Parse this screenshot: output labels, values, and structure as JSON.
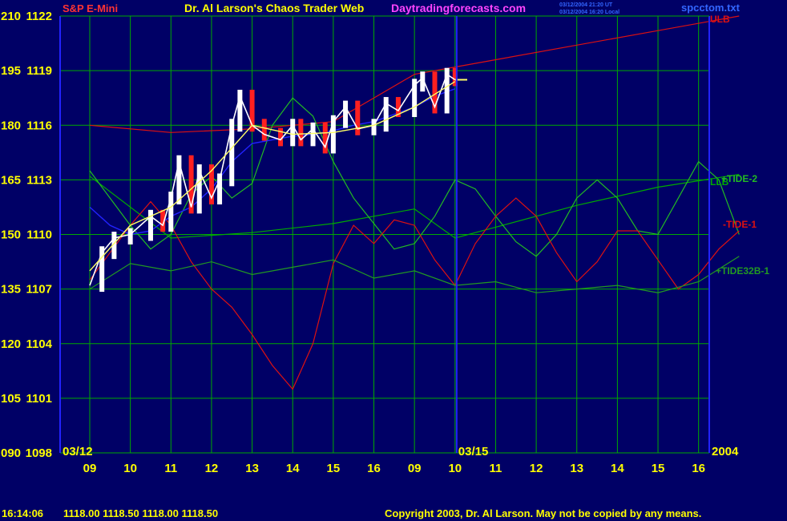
{
  "header": {
    "instrument": "S&P E-Mini",
    "title": "Dr. Al Larson's Chaos Trader Web",
    "site": "Daytradingforecasts.com",
    "timestamp_ut": "03/12/2004 21:20 UT",
    "timestamp_local": "03/12/2004 16:20 Local",
    "filename": "spcctom.txt"
  },
  "footer": {
    "clock": "16:14:06",
    "quote": "1118.00 1118.50 1118.00 1118.50",
    "copyright": "Copyright 2003, Dr. Al Larson. May not be copied by any means."
  },
  "colors": {
    "background": "#000066",
    "grid": "#00aa00",
    "price_bar": "#ffffff",
    "price_bar_down": "#ff2020",
    "axis_text": "#ffff00",
    "band": "#dd1111",
    "tide_1": "#dd1111",
    "tide_2": "#22bb22",
    "tide32b": "#229922",
    "moving_avg": "#ffff66",
    "blue_line": "#2222ff",
    "title": "#ffff00",
    "instrument": "#ff3333",
    "site": "#ff44ff",
    "filename": "#3366ff"
  },
  "chart_data": {
    "type": "line",
    "left_axis_labels": [
      "210",
      "195",
      "180",
      "165",
      "150",
      "135",
      "120",
      "105",
      "090"
    ],
    "price_axis_labels": [
      "1122",
      "1119",
      "1116",
      "1113",
      "1110",
      "1107",
      "1104",
      "1101",
      "1098"
    ],
    "price_range": [
      1098,
      1122
    ],
    "index_range": [
      90,
      210
    ],
    "x_tick_labels": [
      "09",
      "10",
      "11",
      "12",
      "13",
      "14",
      "15",
      "16",
      "09",
      "10",
      "11",
      "12",
      "13",
      "14",
      "15",
      "16"
    ],
    "date_labels": [
      "03/12",
      "03/15",
      "2004"
    ],
    "right_labels": [
      "ULB",
      "LLB",
      "+TIDE-2",
      "-TIDE-1",
      "+TIDE32B-1"
    ],
    "series": [
      {
        "name": "ULB",
        "x": [
          0,
          2,
          4,
          6,
          8,
          9,
          10,
          12,
          14,
          16
        ],
        "values": [
          1116,
          1115.6,
          1115.8,
          1116.2,
          1118.8,
          1119.2,
          1119.6,
          1120.4,
          1121.2,
          1122
        ]
      },
      {
        "name": "LLB",
        "x": [
          0,
          2,
          4,
          6,
          8,
          9,
          10,
          12,
          14,
          16
        ],
        "values": [
          1113.2,
          1109.8,
          1110.1,
          1110.6,
          1111.4,
          1109.8,
          1110.4,
          1111.6,
          1112.6,
          1113.3
        ]
      },
      {
        "name": "+TIDE-2",
        "x": [
          0,
          0.5,
          1,
          1.5,
          2,
          2.5,
          3,
          3.5,
          4,
          4.5,
          5,
          5.5,
          6,
          6.5,
          7,
          7.5,
          8,
          8.5,
          9,
          9.5,
          10,
          10.5,
          11,
          11.5,
          12,
          12.5,
          13,
          13.5,
          14,
          14.5,
          15,
          15.5,
          16
        ],
        "values": [
          1113.5,
          1112,
          1110.5,
          1109.2,
          1110,
          1112.2,
          1113.2,
          1112,
          1112.8,
          1116,
          1117.5,
          1116.5,
          1114,
          1112,
          1110.6,
          1109.2,
          1109.5,
          1111,
          1113,
          1112.5,
          1111,
          1109.6,
          1108.8,
          1110,
          1112,
          1113,
          1112,
          1110.2,
          1110,
          1112,
          1114,
          1113,
          1110
        ]
      },
      {
        "name": "-TIDE-1",
        "x": [
          0,
          0.5,
          1,
          1.5,
          2,
          2.5,
          3,
          3.5,
          4,
          4.5,
          5,
          5.5,
          6,
          6.5,
          7,
          7.5,
          8,
          8.5,
          9,
          9.5,
          10,
          10.5,
          11,
          11.5,
          12,
          12.5,
          13,
          13.5,
          14,
          14.5,
          15,
          15.5,
          16
        ],
        "values": [
          1107.5,
          1109,
          1110.5,
          1111.8,
          1110.5,
          1108.5,
          1107,
          1106,
          1104.5,
          1102.8,
          1101.5,
          1104,
          1108.4,
          1110.5,
          1109.5,
          1110.8,
          1110.5,
          1108.6,
          1107.2,
          1109.5,
          1111,
          1112,
          1111,
          1109,
          1107.4,
          1108.5,
          1110.2,
          1110.2,
          1108.6,
          1107,
          1107.8,
          1109.2,
          1110.2
        ]
      },
      {
        "name": "+TIDE32B-1",
        "x": [
          0,
          1,
          2,
          3,
          4,
          5,
          6,
          7,
          8,
          9,
          10,
          11,
          12,
          13,
          14,
          15,
          16
        ],
        "values": [
          1107,
          1108.4,
          1108,
          1108.5,
          1107.8,
          1108.2,
          1108.6,
          1107.6,
          1108,
          1107.2,
          1107.4,
          1106.8,
          1107,
          1107.2,
          1106.8,
          1107.4,
          1108.8
        ]
      }
    ],
    "price": {
      "x": [
        0,
        0.3,
        0.6,
        1,
        1.5,
        1.8,
        2,
        2.2,
        2.5,
        2.7,
        3,
        3.2,
        3.5,
        3.7,
        4,
        4.3,
        4.7,
        5,
        5.2,
        5.5,
        5.8,
        6,
        6.3,
        6.6,
        7,
        7.3,
        7.6,
        8,
        8.2,
        8.5,
        8.8,
        9
      ],
      "values": [
        1107.2,
        1109,
        1109.8,
        1110,
        1111,
        1110.5,
        1112,
        1114,
        1111.5,
        1113.5,
        1112,
        1113,
        1116,
        1117.6,
        1116,
        1115.5,
        1115.2,
        1116,
        1115.2,
        1115.8,
        1114.8,
        1116.2,
        1117,
        1115.8,
        1116,
        1117.2,
        1116.8,
        1118.2,
        1118.6,
        1117,
        1118.8,
        1118.5
      ]
    },
    "moving_average": {
      "x": [
        0,
        1,
        2,
        3,
        4,
        5,
        6,
        7,
        8,
        9
      ],
      "values": [
        1108,
        1110.5,
        1111.5,
        1113.5,
        1116,
        1115.5,
        1115.6,
        1116,
        1117,
        1118.4
      ]
    },
    "blue_line": {
      "x": [
        0,
        0.5,
        1,
        1.5,
        2,
        2.5,
        3,
        3.5,
        4,
        4.5,
        5,
        5.5,
        6,
        6.5,
        7,
        7.5,
        8,
        8.5,
        9
      ],
      "values": [
        1111.5,
        1110.5,
        1110,
        1110.2,
        1111,
        1111.5,
        1112.5,
        1114,
        1115,
        1115.2,
        1115.4,
        1115.5,
        1115.7,
        1116,
        1116.2,
        1116.6,
        1117,
        1117.6,
        1118
      ]
    },
    "forecast_price": {
      "x": [
        9,
        9.3
      ],
      "values": [
        1118.5,
        1118.5
      ]
    },
    "grid": true
  }
}
